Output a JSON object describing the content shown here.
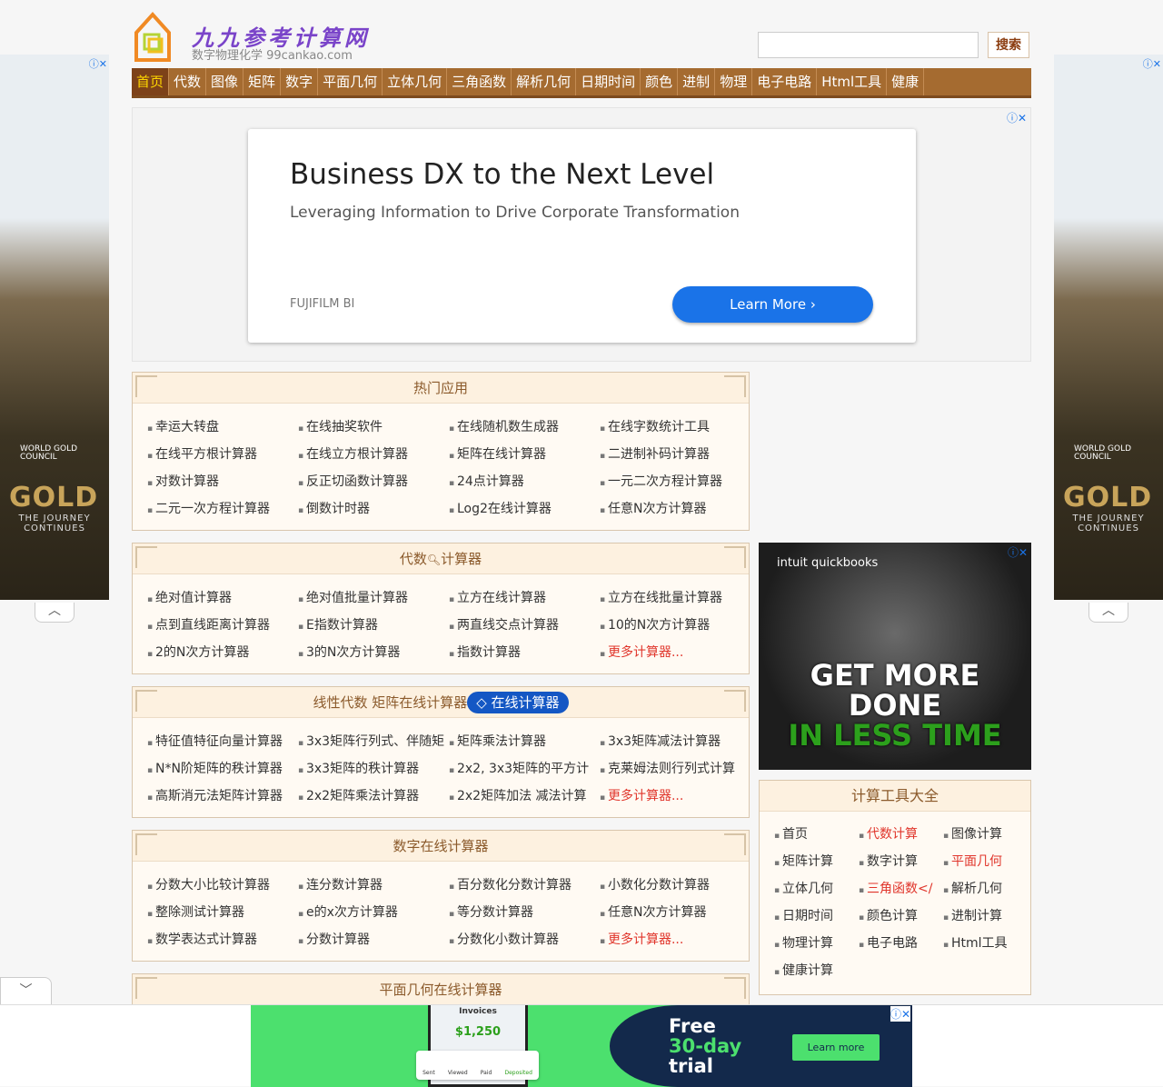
{
  "header": {
    "site_name": "九九参考计算网",
    "tagline": "数字物理化学 99cankao.com",
    "search_placeholder": "",
    "search_label": "搜索"
  },
  "nav": [
    "首页",
    "代数",
    "图像",
    "矩阵",
    "数字",
    "平面几何",
    "立体几何",
    "三角函数",
    "解析几何",
    "日期时间",
    "颜色",
    "进制",
    "物理",
    "电子电路",
    "Html工具",
    "健康"
  ],
  "top_ad": {
    "title": "Business DX to the Next Level",
    "subtitle": "Leveraging Information to Drive Corporate Transformation",
    "brand": "FUJIFILM BI",
    "button": "Learn More ›"
  },
  "sections": [
    {
      "title": "热门应用",
      "items": [
        "幸运大转盘",
        "在线抽奖软件",
        "在线随机数生成器",
        "在线字数统计工具",
        "在线平方根计算器",
        "在线立方根计算器",
        "矩阵在线计算器",
        "二进制补码计算器",
        "对数计算器",
        "反正切函数计算器",
        "24点计算器",
        "一元二次方程计算器",
        "二元一次方程计算器",
        "倒数计时器",
        "Log2在线计算器",
        "任意N次方计算器"
      ]
    },
    {
      "title": "代数",
      "title_suffix": "计算器",
      "items": [
        "绝对值计算器",
        "绝对值批量计算器",
        "立方在线计算器",
        "立方在线批量计算器",
        "点到直线距离计算器",
        "E指数计算器",
        "两直线交点计算器",
        "10的N次方计算器",
        "2的N次方计算器",
        "3的N次方计算器",
        "指数计算器",
        "更多计算器..."
      ]
    },
    {
      "title": "线性代数 矩阵在线计算器",
      "pill": "在线计算器",
      "items": [
        "特征值特征向量计算器",
        "3x3矩阵行列式、伴随矩",
        "矩阵乘法计算器",
        "3x3矩阵减法计算器",
        "N*N阶矩阵的秩计算器",
        "3x3矩阵的秩计算器",
        "2x2, 3x3矩阵的平方计",
        "克莱姆法则行列式计算",
        "高斯消元法矩阵计算器",
        "2x2矩阵乘法计算器",
        "2x2矩阵加法 减法计算",
        "更多计算器..."
      ]
    },
    {
      "title": "数字在线计算器",
      "items": [
        "分数大小比较计算器",
        "连分数计算器",
        "百分数化分数计算器",
        "小数化分数计算器",
        "整除测试计算器",
        "e的x次方计算器",
        "等分数计算器",
        "任意N次方计算器",
        "数学表达式计算器",
        "分数计算器",
        "分数化小数计算器",
        "更多计算器..."
      ]
    },
    {
      "title": "平面几何在线计算器",
      "items": []
    }
  ],
  "qb_ad": {
    "brand": "intuit quickbooks",
    "line1": "GET MORE",
    "line2": "DONE",
    "line3": "IN LESS TIME"
  },
  "tools": {
    "title": "计算工具大全",
    "items": [
      "首页",
      "代数计算",
      "图像计算",
      "矩阵计算",
      "数字计算",
      "平面几何",
      "立体几何",
      "三角函数</",
      "解析几何",
      "日期时间",
      "颜色计算",
      "进制计算",
      "物理计算",
      "电子电路",
      "Html工具",
      "健康计算"
    ],
    "red": [
      1,
      5,
      7
    ]
  },
  "side_ad": {
    "org": "WORLD GOLD COUNCIL",
    "title": "GOLD",
    "tagline": "THE JOURNEY CONTINUES"
  },
  "bottom_ad": {
    "screen_title": "Invoices",
    "amount": "$1,250",
    "steps": [
      "Sent",
      "Viewed",
      "Paid",
      "Deposited"
    ],
    "line1": "Free",
    "line2": "30-day",
    "line3": "trial",
    "button": "Learn more"
  },
  "colors": {
    "nav": "#a56b30",
    "accent": "#1a73e8",
    "link_red": "#e0352b"
  }
}
